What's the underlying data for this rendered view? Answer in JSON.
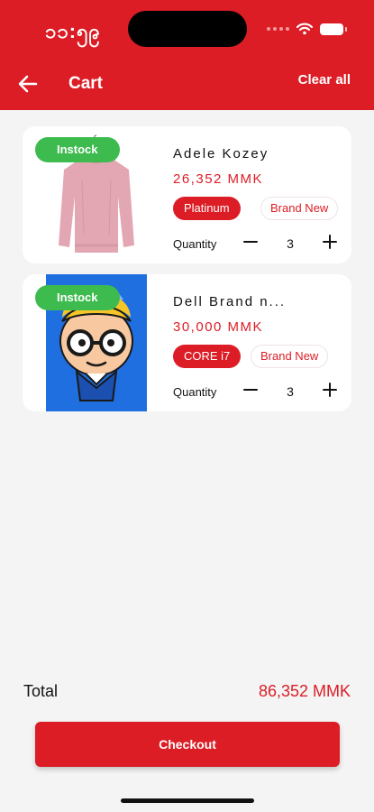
{
  "status_bar": {
    "time": "၁၁:၅၉"
  },
  "header": {
    "title": "Cart",
    "clear_label": "Clear all"
  },
  "cart_items": [
    {
      "stock_label": "Instock",
      "image_icon": "pink-sweater-image",
      "name": "Adele Kozey",
      "price": "26,352 MMK",
      "variant": "Platinum",
      "condition": "Brand New",
      "quantity_label": "Quantity",
      "quantity": "3"
    },
    {
      "stock_label": "Instock",
      "image_icon": "cartoon-nerd-face-image",
      "name": "Dell Brand n...",
      "price": "30,000 MMK",
      "variant": "CORE i7",
      "condition": "Brand New",
      "quantity_label": "Quantity",
      "quantity": "3"
    }
  ],
  "summary": {
    "total_label": "Total",
    "total_value": "86,352 MMK"
  },
  "checkout": {
    "label": "Checkout"
  },
  "colors": {
    "brand": "#dc1d26",
    "instock": "#3dbb4f",
    "background": "#f4f4f4"
  }
}
